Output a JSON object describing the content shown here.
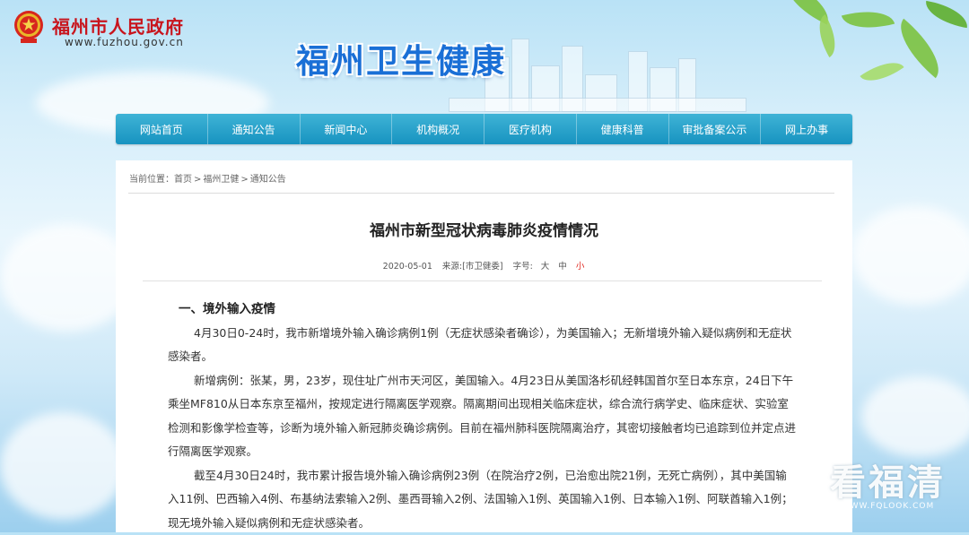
{
  "header": {
    "gov_name": "福州市人民政府",
    "gov_url": "www.fuzhou.gov.cn",
    "site_title": "福州卫生健康"
  },
  "nav": {
    "items": [
      "网站首页",
      "通知公告",
      "新闻中心",
      "机构概况",
      "医疗机构",
      "健康科普",
      "审批备案公示",
      "网上办事"
    ]
  },
  "breadcrumb": {
    "prefix": "当前位置：",
    "items": [
      "首页",
      "福州卫健",
      "通知公告"
    ],
    "sep": ">"
  },
  "article": {
    "title": "福州市新型冠状病毒肺炎疫情情况",
    "date": "2020-05-01",
    "source_label": "来源:",
    "source": "[市卫健委]",
    "font_size_label": "字号:",
    "font_sizes": [
      "大",
      "中",
      "小"
    ],
    "section_heading": "一、境外输入疫情",
    "paragraphs": [
      "4月30日0-24时，我市新增境外输入确诊病例1例（无症状感染者确诊），为美国输入；无新增境外输入疑似病例和无症状感染者。",
      "新增病例：张某，男，23岁，现住址广州市天河区，美国输入。4月23日从美国洛杉矶经韩国首尔至日本东京，24日下午乘坐MF810从日本东京至福州，按规定进行隔离医学观察。隔离期间出现相关临床症状，综合流行病学史、临床症状、实验室检测和影像学检查等，诊断为境外输入新冠肺炎确诊病例。目前在福州肺科医院隔离治疗，其密切接触者均已追踪到位并定点进行隔离医学观察。",
      "截至4月30日24时，我市累计报告境外输入确诊病例23例（在院治疗2例，已治愈出院21例，无死亡病例），其中美国输入11例、巴西输入4例、布基纳法索输入2例、墨西哥输入2例、法国输入1例、英国输入1例、日本输入1例、阿联酋输入1例；现无境外输入疑似病例和无症状感染者。"
    ]
  },
  "watermark": {
    "main": "看福清",
    "url": "WWW.FQLOOK.COM"
  },
  "colors": {
    "gov_red": "#c8151d",
    "title_blue": "#1a6fd6",
    "nav_blue": "#1793c0",
    "active_font_size": "#e0261d"
  }
}
